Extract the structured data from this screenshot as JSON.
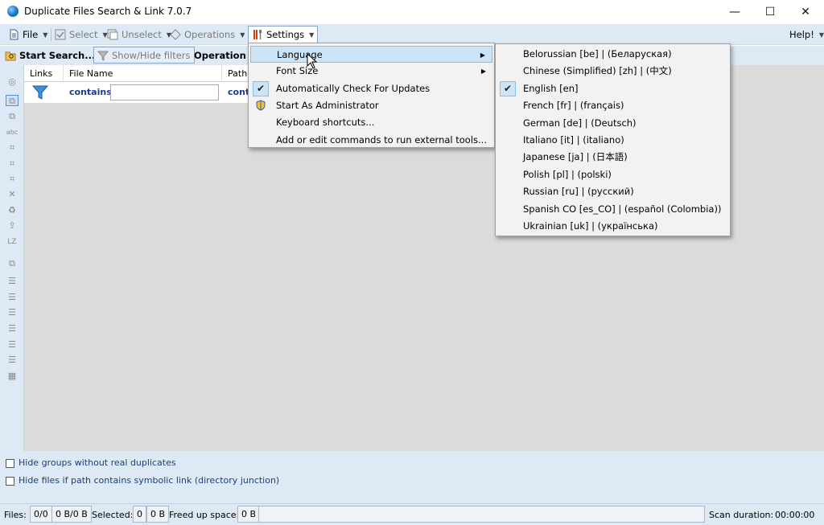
{
  "window": {
    "title": "Duplicate Files Search & Link 7.0.7",
    "minimize": "—",
    "maximize": "☐",
    "close": "✕"
  },
  "menubar": {
    "file": "File",
    "select": "Select",
    "unselect": "Unselect",
    "operations": "Operations",
    "settings": "Settings",
    "help": "Help!"
  },
  "toolbar": {
    "start_search": "Start Search...",
    "show_hide_filters": "Show/Hide filters",
    "operation_mode": "Operation m"
  },
  "grid": {
    "headers": [
      "Links",
      "File Name",
      "Path"
    ],
    "filter_contains": "contains",
    "filter_contains_2": "cont",
    "filter_value": ""
  },
  "left_strip": {
    "lz_label": "LZ"
  },
  "settings_menu": {
    "items": [
      {
        "label": "Language",
        "submenu": true,
        "checked": false
      },
      {
        "label": "Font Size",
        "submenu": true,
        "checked": false
      },
      {
        "label": "Automatically Check For Updates",
        "submenu": false,
        "checked": true
      },
      {
        "label": "Start As Administrator",
        "submenu": false,
        "checked": false,
        "shield": true
      },
      {
        "label": "Keyboard shortcuts...",
        "submenu": false,
        "checked": false
      },
      {
        "label": "Add or edit commands to run external tools...",
        "submenu": false,
        "checked": false
      }
    ]
  },
  "language_menu": {
    "items": [
      {
        "label": "Belorussian [be] | (Беларуская)",
        "checked": false
      },
      {
        "label": "Chinese (Simplified) [zh] | (中文)",
        "checked": false
      },
      {
        "label": "English [en]",
        "checked": true
      },
      {
        "label": "French [fr] | (français)",
        "checked": false
      },
      {
        "label": "German [de] | (Deutsch)",
        "checked": false
      },
      {
        "label": "Italiano [it] | (italiano)",
        "checked": false
      },
      {
        "label": "Japanese [ja] | (日本語)",
        "checked": false
      },
      {
        "label": "Polish [pl] | (polski)",
        "checked": false
      },
      {
        "label": "Russian [ru] | (русский)",
        "checked": false
      },
      {
        "label": "Spanish CO [es_CO] | (español (Colombia))",
        "checked": false
      },
      {
        "label": "Ukrainian [uk] | (українська)",
        "checked": false
      }
    ]
  },
  "options": {
    "hide_groups": "Hide groups without real duplicates",
    "hide_symlink": "Hide files if path contains symbolic link (directory junction)"
  },
  "status": {
    "files_label": "Files:",
    "files_count": "0/0",
    "files_size": "0 B/0 B",
    "selected_label": "Selected:",
    "selected_count": "0",
    "selected_size": "0 B",
    "freed_label": "Freed up space:",
    "freed_value": "0 B",
    "scan_label": "Scan duration:",
    "scan_value": "00:00:00"
  },
  "colors": {
    "accent": "#cce4f7",
    "panel": "#dde9f5",
    "grid_bg": "#dbdbdb",
    "link_blue": "#1f3a93"
  },
  "icons": [
    "globe-app-icon",
    "file-icon",
    "select-icon",
    "unselect-icon",
    "operations-icon",
    "settings-tools-icon",
    "folder-search-icon",
    "filter-icon",
    "funnel-icon",
    "check-icon",
    "shield-icon",
    "submenu-arrow-icon",
    "mouse-cursor-icon"
  ]
}
